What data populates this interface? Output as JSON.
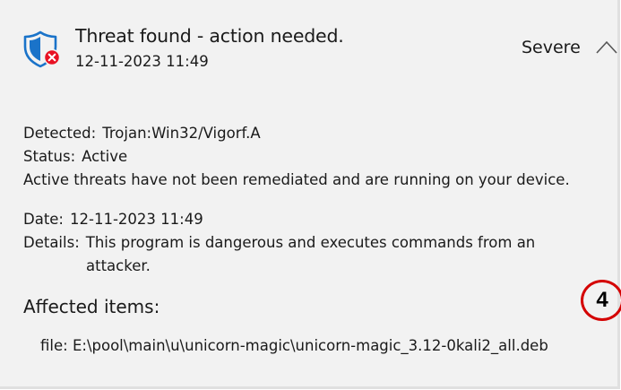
{
  "threat": {
    "title": "Threat found - action needed.",
    "datetime": "12-11-2023 11:49",
    "severity": "Severe",
    "icon": "shield-error-icon",
    "collapse_icon": "chevron-up-icon"
  },
  "details": {
    "detected_label": "Detected:",
    "detected_value": "Trojan:Win32/Vigorf.A",
    "status_label": "Status:",
    "status_value": "Active",
    "status_note": "Active threats have not been remediated and are running on your device.",
    "date_label": "Date:",
    "date_value": "12-11-2023 11:49",
    "details_label": "Details:",
    "details_line1": "This program is dangerous and executes commands from an",
    "details_line2": "attacker."
  },
  "affected": {
    "title": "Affected items:",
    "items": [
      {
        "label": "file:",
        "path": "E:\\pool\\main\\u\\unicorn-magic\\unicorn-magic_3.12-0kali2_all.deb"
      }
    ]
  },
  "annotation": {
    "marker": "4"
  },
  "colors": {
    "shield_blue": "#1a73c9",
    "error_red": "#e81123",
    "marker_red": "#d40000",
    "panel_bg": "#f2f2f2"
  }
}
